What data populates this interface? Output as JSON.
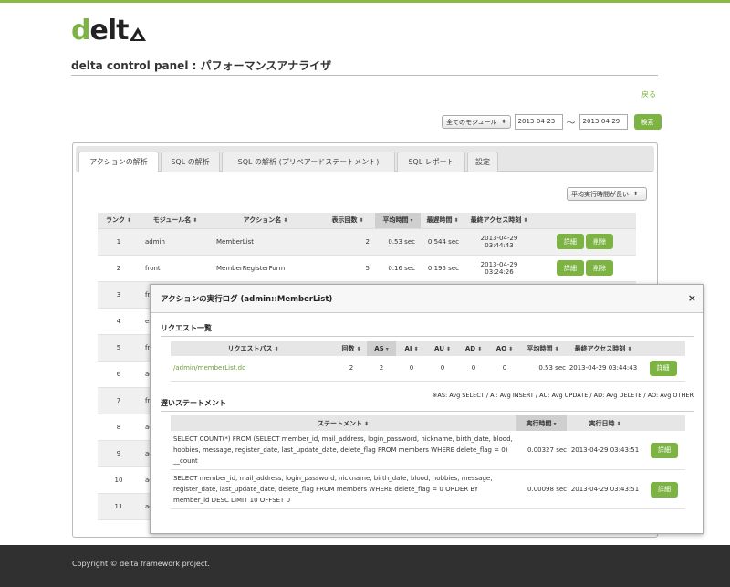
{
  "logo": {
    "text_d": "d",
    "text_rest": "elt"
  },
  "page": {
    "title": "delta control panel : パフォーマンスアナライザ",
    "back": "戻る"
  },
  "filter": {
    "module": "全てのモジュール",
    "date_from": "2013-04-23",
    "separator": "〜",
    "date_to": "2013-04-29",
    "search": "検索"
  },
  "tabs": [
    "アクションの解析",
    "SQL の解析",
    "SQL の解析 (プリペアードステートメント)",
    "SQL レポート",
    "設定"
  ],
  "sort_select": "平均実行時間が長い",
  "table": {
    "headers": [
      "ランク",
      "モジュール名",
      "アクション名",
      "表示回数",
      "平均時間",
      "最遅時間",
      "最終アクセス時刻"
    ],
    "rows": [
      {
        "rank": "1",
        "module": "admin",
        "action": "MemberList",
        "count": "2",
        "avg": "0.53 sec",
        "max": "0.544 sec",
        "date": "2013-04-29",
        "time": "03:44:43"
      },
      {
        "rank": "2",
        "module": "front",
        "action": "MemberRegisterForm",
        "count": "5",
        "avg": "0.16 sec",
        "max": "0.195 sec",
        "date": "2013-04-29",
        "time": "03:24:26"
      },
      {
        "rank": "3",
        "module": "fro"
      },
      {
        "rank": "4",
        "module": "en"
      },
      {
        "rank": "5",
        "module": "fro"
      },
      {
        "rank": "6",
        "module": "ad"
      },
      {
        "rank": "7",
        "module": "fro"
      },
      {
        "rank": "8",
        "module": "ad"
      },
      {
        "rank": "9",
        "module": "ad"
      },
      {
        "rank": "10",
        "module": "ad"
      },
      {
        "rank": "11",
        "module": "ad"
      }
    ],
    "detail_label": "詳細",
    "delete_label": "削除"
  },
  "overlay": {
    "title": "アクションの実行ログ (admin::MemberList)",
    "close": "×",
    "requests_label": "リクエスト一覧",
    "req_headers": [
      "リクエストパス",
      "回数",
      "AS",
      "AI",
      "AU",
      "AD",
      "AO",
      "平均時間",
      "最終アクセス時刻"
    ],
    "req_row": {
      "path": "/admin/memberList.do",
      "count": "2",
      "as": "2",
      "ai": "0",
      "au": "0",
      "ad": "0",
      "ao": "0",
      "avg": "0.53 sec",
      "last": "2013-04-29 03:44:43"
    },
    "note": "※AS: Avg SELECT / AI: Avg INSERT / AU: Avg UPDATE / AD: Avg DELETE / AO: Avg OTHER",
    "slow_label": "遅いステートメント",
    "stmt_headers": [
      "ステートメント",
      "実行時間",
      "実行日時"
    ],
    "stmts": [
      {
        "sql": "SELECT COUNT(*) FROM (SELECT member_id, mail_address, login_password, nickname, birth_date, blood, hobbies, message, register_date, last_update_date, delete_flag FROM members WHERE delete_flag = 0) __count",
        "time": "0.00327 sec",
        "date": "2013-04-29 03:43:51"
      },
      {
        "sql": "SELECT member_id, mail_address, login_password, nickname, birth_date, blood, hobbies, message, register_date, last_update_date, delete_flag FROM members WHERE delete_flag = 0 ORDER BY member_id DESC LIMIT 10 OFFSET 0",
        "time": "0.00098 sec",
        "date": "2013-04-29 03:43:51"
      }
    ]
  },
  "footer": {
    "copyright": "Copyright © delta framework project."
  },
  "colors": {
    "accent": "#7cb342",
    "footer": "#303030"
  }
}
